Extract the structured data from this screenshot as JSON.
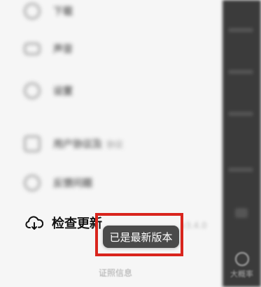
{
  "menu": {
    "items": [
      {
        "label": "下载",
        "icon": "download-icon"
      },
      {
        "label": "声音",
        "icon": "sound-icon"
      },
      {
        "label": "设置",
        "icon": "settings-icon"
      },
      {
        "label": "用户协议及",
        "sub": "协议",
        "icon": "agreement-icon"
      },
      {
        "label": "反馈问题",
        "icon": "feedback-icon"
      }
    ],
    "check_update": {
      "label": "检查更新",
      "icon": "cloud-refresh-icon",
      "version": "v3.4.0"
    }
  },
  "footer": {
    "license_link": "证照信息"
  },
  "toast": {
    "message": "已是最新版本",
    "highlight_color": "#d9251d"
  },
  "right_strip": {
    "tab_label": "大概率"
  }
}
